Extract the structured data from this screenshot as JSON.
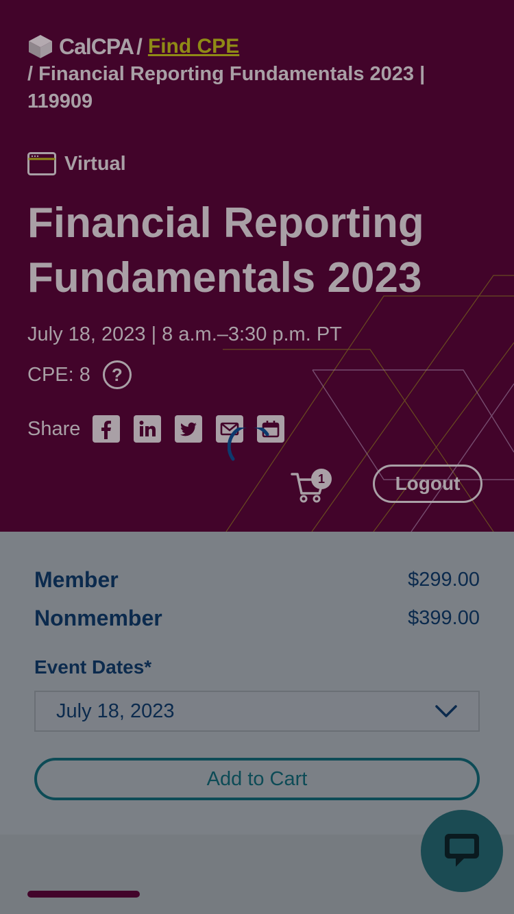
{
  "header": {
    "logo_text": "CalCPA",
    "separator": "/",
    "find_link": "Find CPE",
    "crumb_rest": "/ Financial Reporting Fundamentals 2023 | 119909"
  },
  "event": {
    "format_label": "Virtual",
    "title": "Financial Reporting Fundamentals 2023",
    "date_line": "July 18, 2023 | 8 a.m.–3:30 p.m. PT",
    "cpe_text": "CPE: 8",
    "help_label": "?",
    "share_label": "Share",
    "share_icons": [
      "facebook-icon",
      "linkedin-icon",
      "twitter-icon",
      "email-icon",
      "calendar-icon"
    ]
  },
  "cart": {
    "count": "1"
  },
  "auth": {
    "logout_label": "Logout"
  },
  "pricing": {
    "rows": [
      {
        "name": "Member",
        "price": "$299.00"
      },
      {
        "name": "Nonmember",
        "price": "$399.00"
      }
    ],
    "dates_label": "Event Dates*",
    "selected_date": "July 18, 2023",
    "add_to_cart_label": "Add to Cart"
  },
  "colors": {
    "hero_bg": "#42042a",
    "accent_link": "#8f8a16",
    "text_dark_blue": "#0b2a4d",
    "teal": "#0d4b56",
    "overlay_gray": "#7b8086"
  }
}
